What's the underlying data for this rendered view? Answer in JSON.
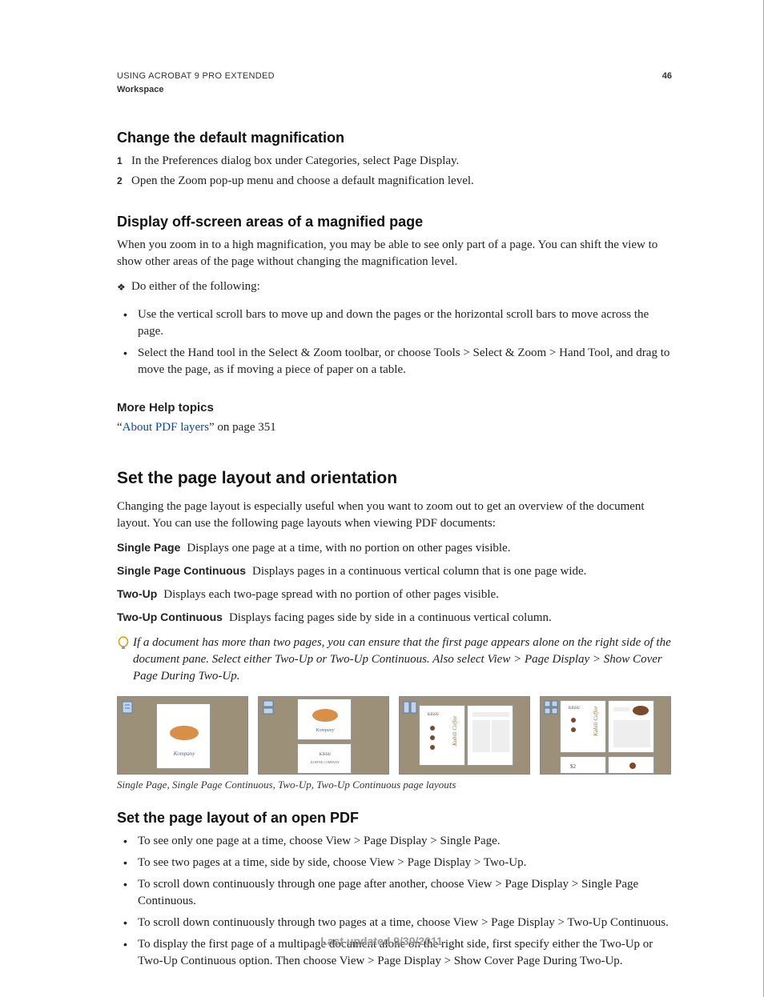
{
  "header": {
    "product": "USING ACROBAT 9 PRO EXTENDED",
    "section": "Workspace",
    "page_number": "46"
  },
  "sec1": {
    "heading": "Change the default magnification",
    "steps": [
      "In the Preferences dialog box under Categories, select Page Display.",
      "Open the Zoom pop-up menu and choose a default magnification level."
    ]
  },
  "sec2": {
    "heading": "Display off-screen areas of a magnified page",
    "intro": "When you zoom in to a high magnification, you may be able to see only part of a page. You can shift the view to show other areas of the page without changing the magnification level.",
    "lead": "Do either of the following:",
    "bullets": [
      "Use the vertical scroll bars to move up and down the pages or the horizontal scroll bars to move across the page.",
      "Select the Hand tool in the Select & Zoom toolbar, or choose Tools > Select & Zoom > Hand Tool, and drag to move the page, as if moving a piece of paper on a table."
    ]
  },
  "more_help": {
    "heading": "More Help topics",
    "quote_open": "“",
    "link_text": "About PDF layers",
    "suffix": "” on page 351"
  },
  "sec3": {
    "heading": "Set the page layout and orientation",
    "intro": "Changing the page layout is especially useful when you want to zoom out to get an overview of the document layout. You can use the following page layouts when viewing PDF documents:",
    "defs": [
      {
        "term": "Single Page",
        "def": "Displays one page at a time, with no portion on other pages visible."
      },
      {
        "term": "Single Page Continuous",
        "def": "Displays pages in a continuous vertical column that is one page wide."
      },
      {
        "term": "Two-Up",
        "def": "Displays each two-page spread with no portion of other pages visible."
      },
      {
        "term": "Two-Up Continuous",
        "def": "Displays facing pages side by side in a continuous vertical column."
      }
    ],
    "tip": "If a document has more than two pages, you can ensure that the first page appears alone on the right side of the document pane. Select either Two-Up or Two-Up Continuous. Also select View > Page Display > Show Cover Page During Two-Up.",
    "caption": "Single Page, Single Page Continuous, Two-Up, Two-Up Continuous page layouts"
  },
  "sec4": {
    "heading": "Set the page layout of an open PDF",
    "bullets": [
      "To see only one page at a time, choose View > Page Display > Single Page.",
      "To see two pages at a time, side by side, choose View > Page Display > Two-Up.",
      "To scroll down continuously through one page after another, choose View > Page Display > Single Page Continuous.",
      "To scroll down continuously through two pages at a time, choose View > Page Display > Two-Up Continuous.",
      "To display the first page of a multipage document alone on the right side, first specify either the Two-Up or Two-Up Continuous option. Then choose View > Page Display > Show Cover Page During Two-Up."
    ]
  },
  "footer": "Last updated 9/30/2011"
}
